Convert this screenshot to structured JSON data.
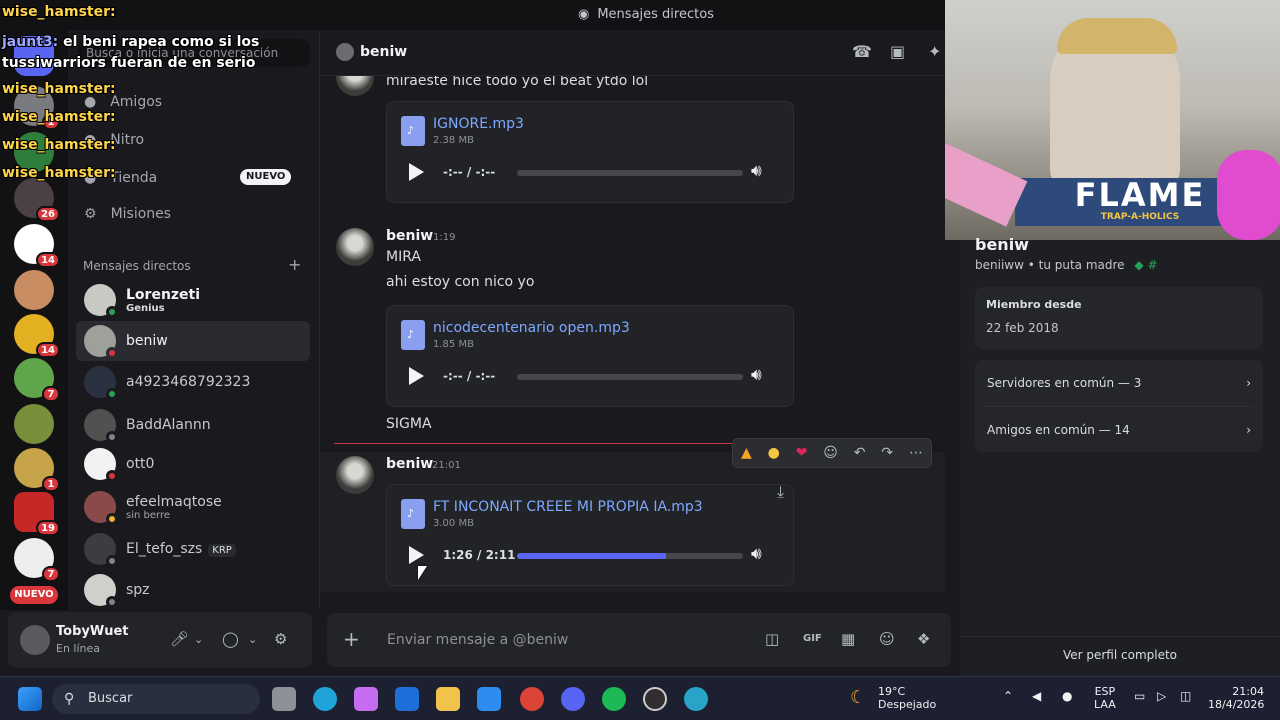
{
  "window": {
    "title": "Mensajes directos"
  },
  "colors": {
    "accent": "#5865f2",
    "danger": "#da373c",
    "link": "#7ea8ff",
    "online": "#23a55a"
  },
  "overlay": {
    "messages": [
      {
        "user": "wise_hamster:",
        "text": ""
      },
      {
        "user": "jaunt3:",
        "text": "el beni rapea como si los"
      },
      {
        "user": "",
        "text": "tussiwarriors fueran de en serio"
      },
      {
        "user": "wise_hamster:",
        "text": ""
      },
      {
        "user": "wise_hamster:",
        "text": ""
      },
      {
        "user": "wise_hamster:",
        "text": ""
      },
      {
        "user": "wise_hamster:",
        "text": ""
      }
    ]
  },
  "rail": {
    "badges": [
      "1",
      "26",
      "14",
      "14",
      "7",
      "1",
      "19",
      "7"
    ],
    "new_label": "NUEVO"
  },
  "sidebar": {
    "search_placeholder": "Busca o inicia una conversación",
    "nav": [
      {
        "label": "Amigos",
        "icon": "friends-icon"
      },
      {
        "label": "Nitro",
        "icon": "nitro-icon"
      },
      {
        "label": "Tienda",
        "icon": "shop-icon",
        "badge": "NUEVO"
      },
      {
        "label": "Misiones",
        "icon": "quests-icon"
      }
    ],
    "dm_header": "Mensajes directos",
    "dms": [
      {
        "name": "Lorenzeti",
        "sub": "Genius",
        "bold": true
      },
      {
        "name": "beniw",
        "sub": "",
        "bold": false,
        "active": true
      },
      {
        "name": "a4923468792323",
        "sub": ""
      },
      {
        "name": "BaddAlannn",
        "sub": ""
      },
      {
        "name": "ott0",
        "sub": ""
      },
      {
        "name": "efeelmaqtose",
        "sub": "sin berre"
      },
      {
        "name": "El_tefo_szs",
        "sub": "",
        "tag": "KRP"
      },
      {
        "name": "spz",
        "sub": ""
      }
    ]
  },
  "user_panel": {
    "name": "TobyWuet",
    "status": "En línea"
  },
  "chat": {
    "channel_name": "beniw",
    "messages": [
      {
        "author": "",
        "time": "",
        "text": "miraeste hice todo yo el beat ytdo lol"
      },
      {
        "author": "beniw",
        "time": "1:19",
        "lines": [
          "MIRA",
          "ahi estoy con nico yo"
        ]
      },
      {
        "author": "",
        "time": "",
        "text": "SIGMA"
      },
      {
        "author": "beniw",
        "time": "21:01",
        "text": ""
      }
    ],
    "attachments": [
      {
        "filename": "IGNORE.mp3",
        "size": "2.38 MB",
        "time": "-:-- / -:--",
        "progress": 0
      },
      {
        "filename": "nicodecentenario open.mp3",
        "size": "1.85 MB",
        "time": "-:-- / -:--",
        "progress": 0
      },
      {
        "filename": "FT INCONAIT CREEE MI PROPIA IA.mp3",
        "size": "3.00 MB",
        "time": "1:26 / 2:11",
        "progress": 0.66
      }
    ],
    "composer_placeholder": "Enviar mensaje a @beniw"
  },
  "profile": {
    "display_name": "beniw",
    "username": "beniiww",
    "pronoun_text": "tu puta madre",
    "member_since_label": "Miembro desde",
    "member_since_value": "22 feb 2018",
    "servers_common": "Servidores en común — 3",
    "friends_common": "Amigos en común — 14",
    "full_profile": "Ver perfil completo",
    "webcam_banner": "FLAME",
    "webcam_sub": "TRAP-A-HOLICS"
  },
  "taskbar": {
    "search_label": "Buscar",
    "weather_temp": "19°C",
    "weather_desc": "Despejado",
    "lang": "ESP",
    "lang_sub": "LAA",
    "time": "21:04",
    "date": "18/4/2026"
  }
}
